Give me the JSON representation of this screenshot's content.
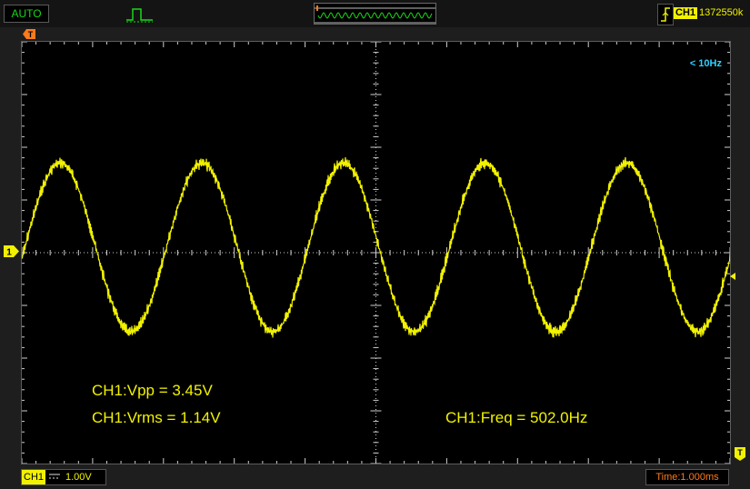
{
  "top": {
    "mode": "AUTO",
    "trigger_source": "CH1",
    "trigger_value": "1372550k",
    "colors": {
      "mode": "#18d818",
      "trace": "#f2f200"
    }
  },
  "display": {
    "freq_indicator": "< 10Hz",
    "channel_marker": "1",
    "trigger_marker": "T",
    "grid": {
      "hdivs": 10,
      "vdivs": 8
    },
    "colors": {
      "trace": "#f2f200",
      "grid": "#cfcfcf",
      "freq_indicator": "#2fd0ff",
      "marker": "#ff7a1a"
    }
  },
  "measurements": {
    "vpp": "CH1:Vpp = 3.45V",
    "vrms": "CH1:Vrms = 1.14V",
    "freq": "CH1:Freq = 502.0Hz"
  },
  "bottom": {
    "channel": "CH1",
    "coupling_icon": "dc-coupling-icon",
    "volts_div": "1.00V",
    "time_base": "Time:1.000ms"
  },
  "chart_data": {
    "type": "line",
    "title": "",
    "xlabel": "",
    "ylabel": "",
    "time_per_div_ms": 1.0,
    "volts_per_div": 1.0,
    "xlim": [
      0,
      10
    ],
    "ylim": [
      -4,
      4
    ],
    "grid": true,
    "series": [
      {
        "waveform": "sine",
        "frequency_hz": 502.0,
        "amplitude_v": 1.6,
        "offset_v": 0.1,
        "cycles_visible": 5,
        "noise": true
      }
    ]
  }
}
